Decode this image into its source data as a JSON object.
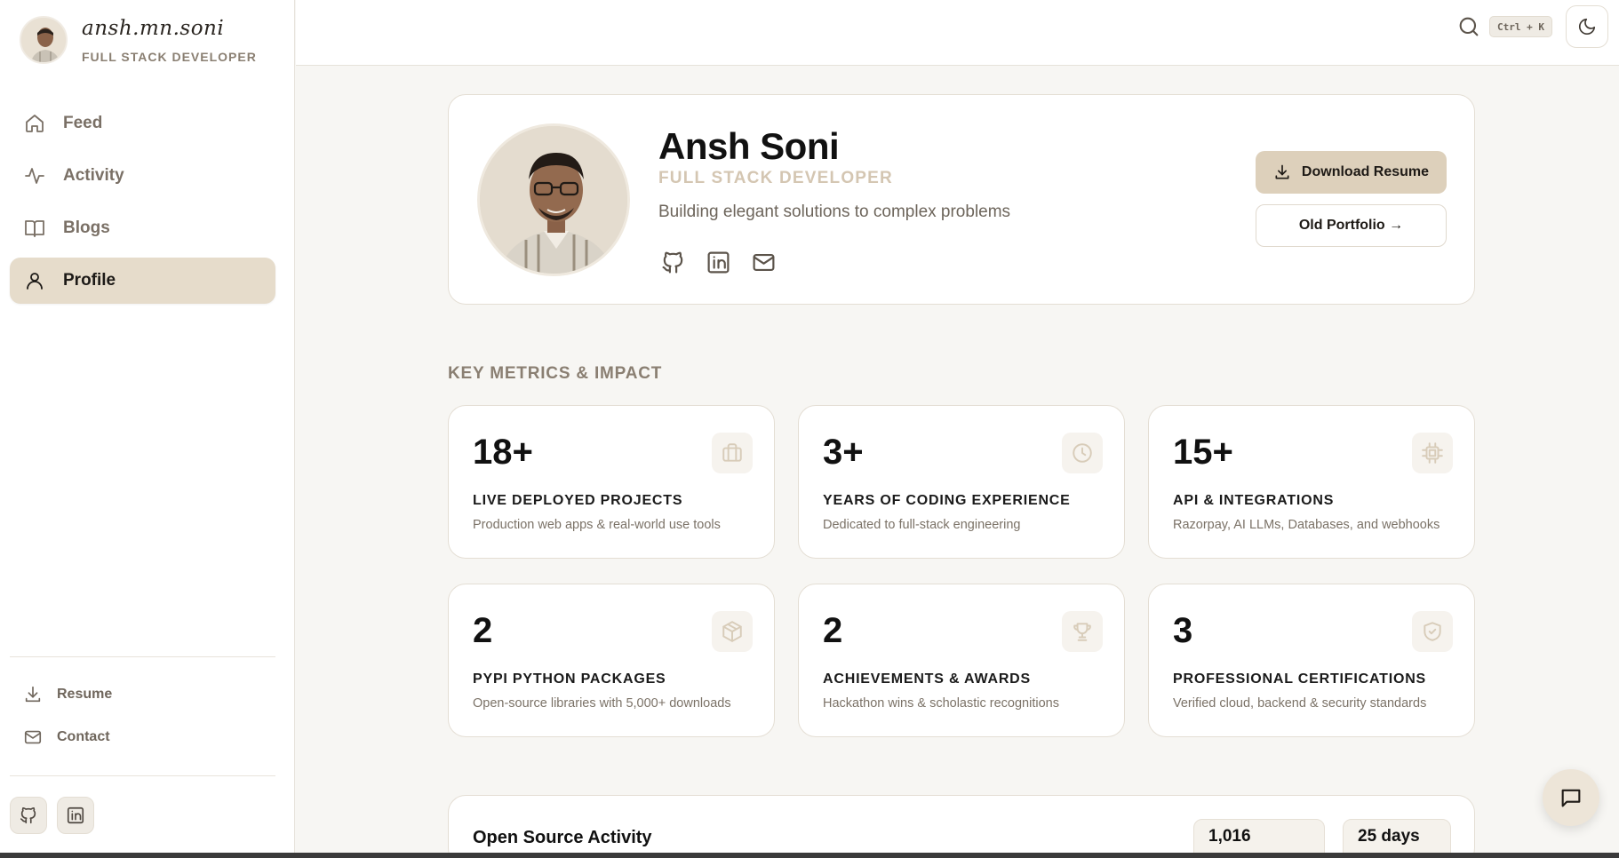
{
  "brand": {
    "handle": "ansh.mn.soni",
    "role": "FULL STACK DEVELOPER"
  },
  "nav": {
    "items": [
      {
        "label": "Feed",
        "icon": "home-icon"
      },
      {
        "label": "Activity",
        "icon": "activity-icon"
      },
      {
        "label": "Blogs",
        "icon": "book-icon"
      },
      {
        "label": "Profile",
        "icon": "user-icon",
        "active": true
      }
    ]
  },
  "sidebar_utils": {
    "resume_label": "Resume",
    "contact_label": "Contact"
  },
  "sidebar_social": [
    "github-icon",
    "linkedin-icon"
  ],
  "topbar": {
    "shortcut": "Ctrl + K",
    "theme_icon": "moon-icon"
  },
  "profile": {
    "name": "Ansh Soni",
    "role": "FULL STACK DEVELOPER",
    "tagline": "Building elegant solutions to complex problems",
    "socials": [
      "github-icon",
      "linkedin-icon",
      "mail-icon"
    ],
    "download_label": "Download Resume",
    "old_portfolio_label": "Old Portfolio →"
  },
  "metrics": {
    "section_title": "KEY METRICS & IMPACT",
    "items": [
      {
        "value": "18+",
        "title": "LIVE DEPLOYED PROJECTS",
        "desc": "Production web apps & real-world use tools",
        "icon": "briefcase-icon"
      },
      {
        "value": "3+",
        "title": "YEARS OF CODING EXPERIENCE",
        "desc": "Dedicated to full-stack engineering",
        "icon": "clock-icon"
      },
      {
        "value": "15+",
        "title": "API & INTEGRATIONS",
        "desc": "Razorpay, AI LLMs, Databases, and webhooks",
        "icon": "chip-icon"
      },
      {
        "value": "2",
        "title": "PYPI PYTHON PACKAGES",
        "desc": "Open-source libraries with 5,000+ downloads",
        "icon": "package-icon"
      },
      {
        "value": "2",
        "title": "ACHIEVEMENTS & AWARDS",
        "desc": "Hackathon wins & scholastic recognitions",
        "icon": "trophy-icon"
      },
      {
        "value": "3",
        "title": "PROFESSIONAL CERTIFICATIONS",
        "desc": "Verified cloud, backend & security standards",
        "icon": "shield-check-icon"
      }
    ]
  },
  "open_source": {
    "title": "Open Source Activity",
    "stat_1": "1,016",
    "stat_2": "25 days"
  },
  "colors": {
    "accent": "#e6dccb",
    "page_bg": "#f7f6f3",
    "button_bg": "#ddd0bb"
  }
}
